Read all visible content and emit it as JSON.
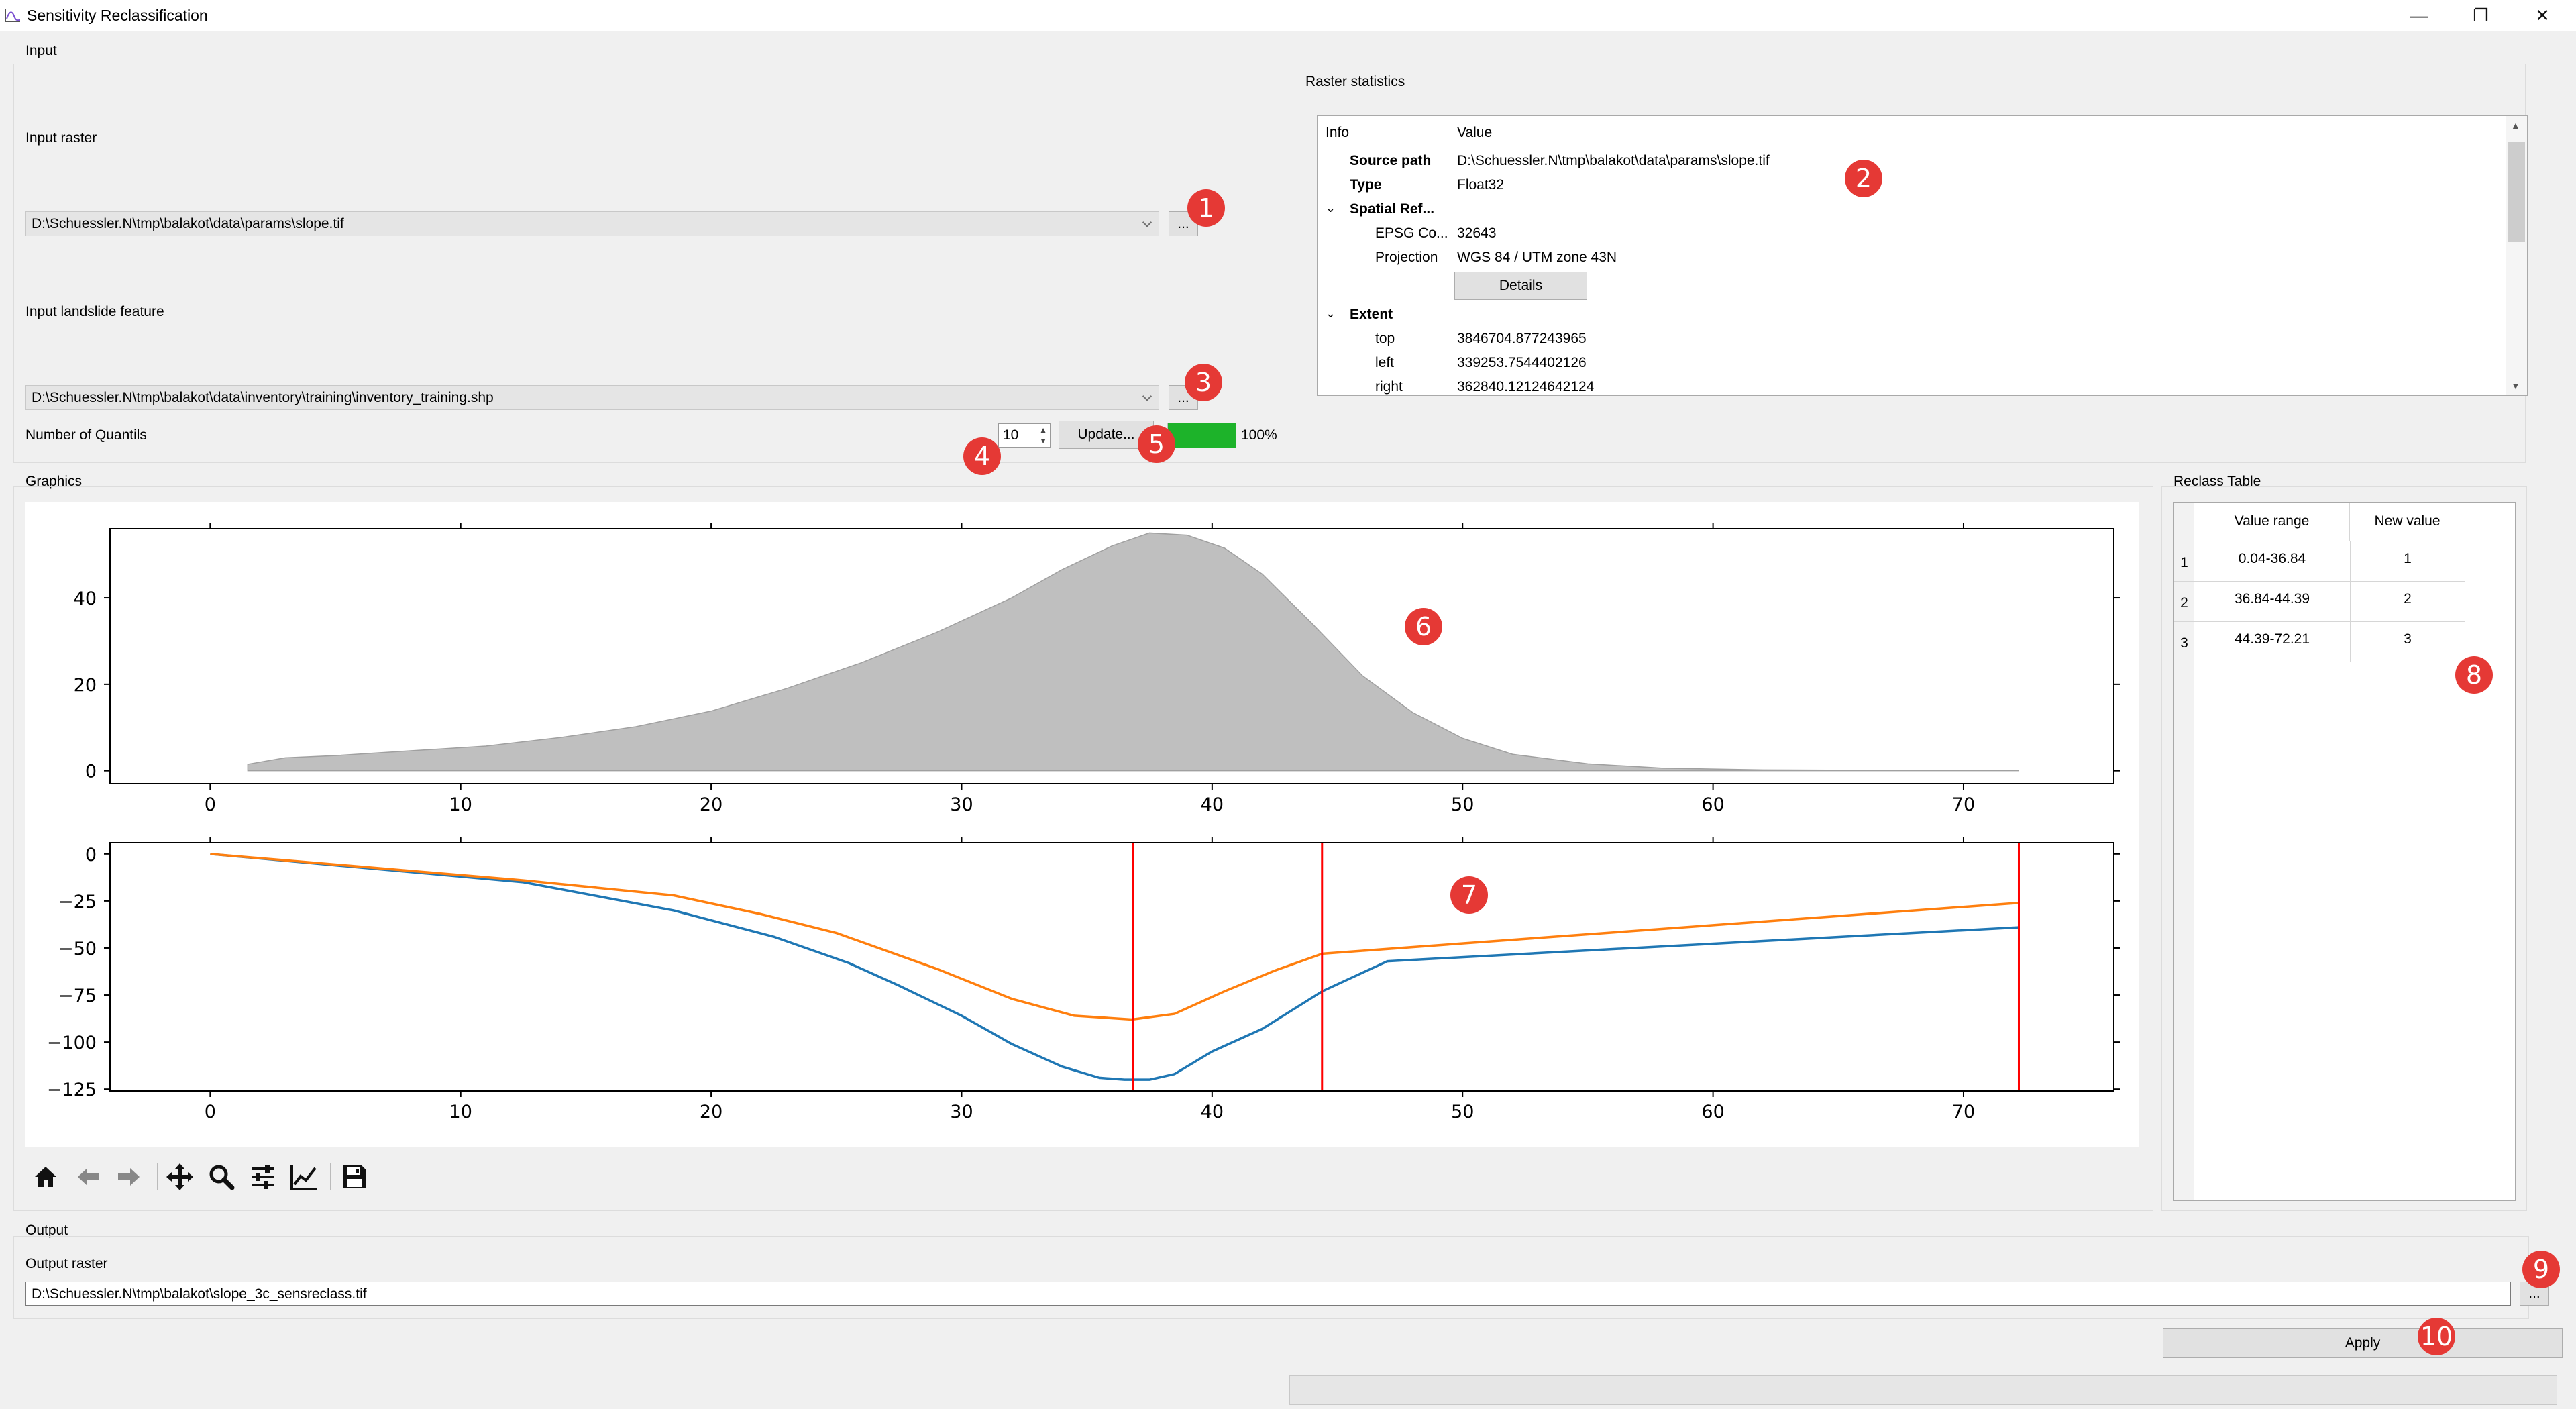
{
  "window": {
    "title": "Sensitivity Reclassification"
  },
  "input": {
    "group_label": "Input",
    "raster_label": "Input raster",
    "raster_value": "D:\\Schuessler.N\\tmp\\balakot\\data\\params\\slope.tif",
    "browse_label": "...",
    "landslide_label": "Input landslide feature",
    "landslide_value": "D:\\Schuessler.N\\tmp\\balakot\\data\\inventory\\training\\inventory_training.shp",
    "quantils_label": "Number of Quantils",
    "quantils_value": "10",
    "update_label": "Update...",
    "progress_text": "100%",
    "progress_value": 1.0
  },
  "stats": {
    "group_label": "Raster statistics",
    "col_info": "Info",
    "col_value": "Value",
    "rows": [
      {
        "key": "Source path",
        "value": "D:\\Schuessler.N\\tmp\\balakot\\data\\params\\slope.tif"
      },
      {
        "key": "Type",
        "value": "Float32"
      },
      {
        "key": "Spatial Ref...",
        "value": ""
      },
      {
        "key": "EPSG Co...",
        "value": "32643"
      },
      {
        "key": "Projection",
        "value": "WGS 84 / UTM zone 43N"
      },
      {
        "key": "",
        "value": ""
      },
      {
        "key": "Extent",
        "value": ""
      },
      {
        "key": "top",
        "value": "3846704.877243965"
      },
      {
        "key": "left",
        "value": "339253.7544402126"
      },
      {
        "key": "right",
        "value": "362840.12124642124"
      }
    ],
    "details_label": "Details"
  },
  "graphics": {
    "group_label": "Graphics"
  },
  "reclass": {
    "group_label": "Reclass Table",
    "headers": [
      "Value range",
      "New value"
    ],
    "rows": [
      {
        "index": "1",
        "range": "0.04-36.84",
        "value": "1"
      },
      {
        "index": "2",
        "range": "36.84-44.39",
        "value": "2"
      },
      {
        "index": "3",
        "range": "44.39-72.21",
        "value": "3"
      }
    ]
  },
  "output": {
    "group_label": "Output",
    "raster_label": "Output raster",
    "raster_value": "D:\\Schuessler.N\\tmp\\balakot\\slope_3c_sensreclass.tif",
    "browse_label": "...",
    "apply_label": "Apply"
  },
  "badges": [
    "1",
    "2",
    "3",
    "4",
    "5",
    "6",
    "7",
    "8",
    "9",
    "10"
  ],
  "toolbar_icons": [
    "home-icon",
    "back-arrow-icon",
    "forward-arrow-icon",
    "pan-icon",
    "zoom-icon",
    "configure-subplots-icon",
    "edit-axis-icon",
    "save-icon"
  ],
  "colors": {
    "progress": "#1db32a",
    "badge": "#e53935",
    "series_blue": "#1f77b4",
    "series_orange": "#ff7f0e",
    "breaks": "#ff0000",
    "density_fill": "#bfbfbf"
  },
  "chart_data": [
    {
      "type": "area",
      "xlim": [
        -4,
        76
      ],
      "ylim": [
        -3,
        56
      ],
      "xticks": [
        0,
        10,
        20,
        30,
        40,
        50,
        60,
        70
      ],
      "yticks": [
        0,
        20,
        40
      ],
      "x": [
        1.5,
        3,
        5,
        8,
        11,
        14,
        17,
        20,
        23,
        26,
        29,
        32,
        34,
        36,
        37.5,
        39,
        40.5,
        42,
        44,
        46,
        48,
        50,
        52,
        55,
        58,
        62,
        66,
        72.2
      ],
      "y": [
        1.5,
        3,
        3.5,
        4.6,
        5.7,
        7.7,
        10.2,
        13.8,
        19,
        25,
        32,
        40,
        46.5,
        52,
        55,
        54.5,
        51.5,
        45.5,
        34,
        22,
        13.5,
        7.5,
        3.8,
        1.6,
        0.6,
        0.2,
        0.1,
        0
      ]
    },
    {
      "type": "line",
      "xlim": [
        -4,
        76
      ],
      "ylim": [
        -126,
        6
      ],
      "xticks": [
        0,
        10,
        20,
        30,
        40,
        50,
        60,
        70
      ],
      "yticks": [
        0,
        -25,
        -50,
        -75,
        -100,
        -125
      ],
      "vlines": [
        36.84,
        44.39,
        72.21
      ],
      "series": [
        {
          "color": "#1f77b4",
          "x": [
            0,
            12.5,
            18.5,
            22.5,
            25.5,
            27.5,
            30,
            32,
            34,
            35.5,
            36.5,
            37.5,
            38.5,
            40,
            42,
            44.4,
            47,
            72.2
          ],
          "y": [
            0,
            -15,
            -30,
            -44,
            -58,
            -70,
            -86,
            -101,
            -113,
            -119,
            -120,
            -120,
            -117,
            -105,
            -93,
            -73,
            -57,
            -39
          ]
        },
        {
          "color": "#ff7f0e",
          "x": [
            0,
            12.5,
            18.5,
            22,
            25,
            29,
            32,
            34.5,
            36.8,
            38.5,
            40.5,
            42.5,
            44.4,
            72.2
          ],
          "y": [
            0,
            -14,
            -22,
            -32,
            -42,
            -61,
            -77,
            -86,
            -88,
            -85,
            -73,
            -62,
            -53,
            -26
          ]
        }
      ]
    }
  ]
}
